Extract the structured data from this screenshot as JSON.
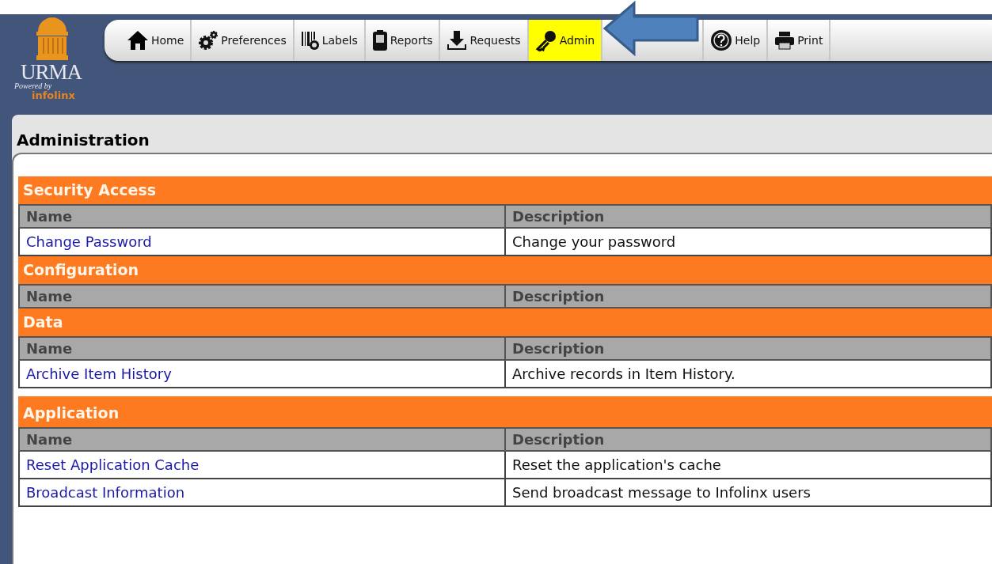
{
  "logo": {
    "name": "URMA",
    "tagline": "Powered by",
    "brand": "infolinx"
  },
  "toolbar": [
    {
      "kind": "button",
      "label": "Home",
      "selected": false
    },
    {
      "kind": "button",
      "label": "Preferences",
      "selected": false
    },
    {
      "kind": "button",
      "label": "Labels",
      "selected": false
    },
    {
      "kind": "button",
      "label": "Reports",
      "selected": false
    },
    {
      "kind": "button",
      "label": "Requests",
      "selected": false
    },
    {
      "kind": "button",
      "label": "Admin",
      "selected": true
    },
    {
      "kind": "covered"
    },
    {
      "kind": "button",
      "label": "Help",
      "selected": false
    },
    {
      "kind": "button",
      "label": "Print",
      "selected": false
    }
  ],
  "page_title": "Administration",
  "sections": [
    {
      "title": "Security Access",
      "columns": [
        "Name",
        "Description"
      ],
      "rows": [
        {
          "name": "Change Password",
          "description": "Change your password"
        }
      ]
    },
    {
      "title": "Configuration",
      "columns": [
        "Name",
        "Description"
      ]
    },
    {
      "title": "Data",
      "columns": [
        "Name",
        "Description"
      ],
      "rows": [
        {
          "name": "Archive Item History",
          "description": "Archive records in Item History."
        }
      ]
    },
    {
      "title": "Application",
      "columns": [
        "Name",
        "Description"
      ],
      "rows": [
        {
          "name": "Reset Application Cache",
          "description": "Reset the application's cache"
        },
        {
          "name": "Broadcast Information",
          "description": "Send broadcast message to Infolinx users"
        }
      ]
    }
  ]
}
